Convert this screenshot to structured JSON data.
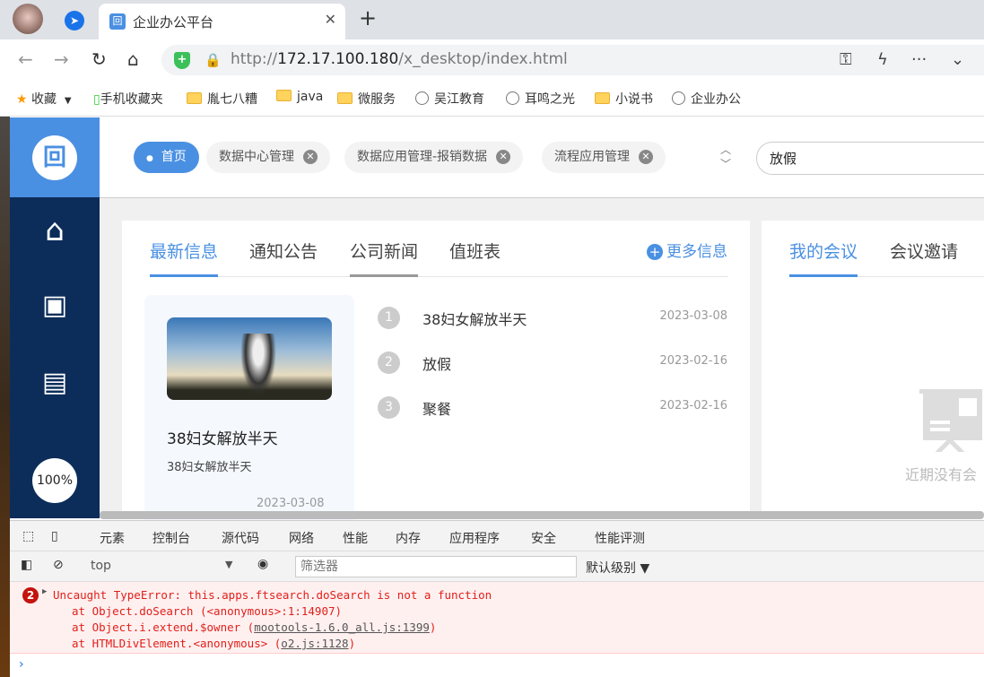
{
  "browser": {
    "tab_title": "企业办公平台",
    "url_prefix": "http://",
    "url_host": "172.17.100.180",
    "url_path": "/x_desktop/index.html",
    "bookmarks": [
      "收藏",
      "手机收藏夹",
      "胤七八糟",
      "java",
      "微服务",
      "吴江教育",
      "耳鸣之光",
      "小说书",
      "企业办公"
    ]
  },
  "sidebar": {
    "zoom": "100%"
  },
  "header": {
    "tabs": [
      {
        "label": "首页"
      },
      {
        "label": "数据中心管理"
      },
      {
        "label": "数据应用管理-报销数据"
      },
      {
        "label": "流程应用管理"
      }
    ],
    "search_value": "放假"
  },
  "news": {
    "tabs": [
      "最新信息",
      "通知公告",
      "公司新闻",
      "值班表"
    ],
    "more": "更多信息",
    "featured": {
      "title": "38妇女解放半天",
      "summary": "38妇女解放半天",
      "date": "2023-03-08"
    },
    "items": [
      {
        "n": "1",
        "title": "38妇女解放半天",
        "date": "2023-03-08"
      },
      {
        "n": "2",
        "title": "放假",
        "date": "2023-02-16"
      },
      {
        "n": "3",
        "title": "聚餐",
        "date": "2023-02-16"
      }
    ]
  },
  "meetings": {
    "tabs": [
      "我的会议",
      "会议邀请"
    ],
    "empty": "近期没有会"
  },
  "devtools": {
    "tabs": [
      "元素",
      "控制台",
      "源代码",
      "网络",
      "性能",
      "内存",
      "应用程序",
      "安全",
      "性能评测"
    ],
    "context": "top",
    "filter_placeholder": "筛选器",
    "level": "默认级别 ▼",
    "error_count": "2",
    "error": "Uncaught TypeError: this.apps.ftsearch.doSearch is not a function",
    "stack": [
      {
        "text": "at Object.doSearch (<anonymous>:1:14907)",
        "link": ""
      },
      {
        "text": "at Object.i.extend.$owner (",
        "link": "mootools-1.6.0_all.js:1399"
      },
      {
        "text": "at HTMLDivElement.<anonymous> (",
        "link": "o2.js:1128"
      }
    ]
  }
}
